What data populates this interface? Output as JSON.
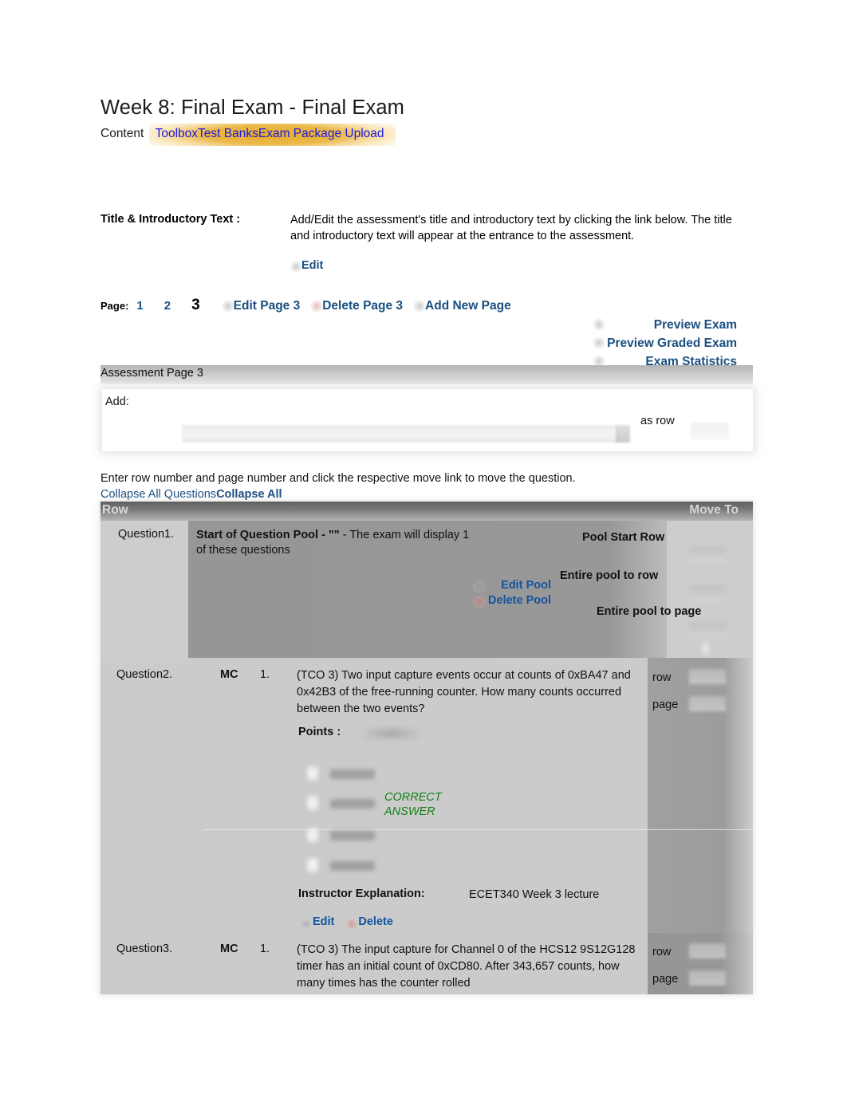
{
  "header": {
    "title": "Week 8: Final Exam - Final Exam",
    "breadcrumb_static": "Content",
    "breadcrumb_links": [
      {
        "label": "Toolbox"
      },
      {
        "label": "Test Banks"
      },
      {
        "label": "Exam Package Upload"
      }
    ]
  },
  "intro": {
    "label": "Title & Introductory Text :",
    "text": "Add/Edit the assessment's title and introductory text by clicking the link below. The title and introductory text will appear at the entrance to the assessment.",
    "edit_label": "Edit"
  },
  "pagenav": {
    "label": "Page:",
    "pages": [
      {
        "label": "1",
        "current": false
      },
      {
        "label": "2",
        "current": false
      },
      {
        "label": "3",
        "current": true
      }
    ],
    "actions": [
      {
        "label": "Edit Page 3"
      },
      {
        "label": "Delete Page 3"
      },
      {
        "label": "Add New Page"
      }
    ],
    "right_links": [
      {
        "label": "Preview Exam"
      },
      {
        "label": "Preview Graded Exam"
      },
      {
        "label": "Exam Statistics"
      }
    ]
  },
  "assessment_bar": {
    "title": "Assessment Page 3"
  },
  "add_panel": {
    "label": "Add:",
    "select_value": "",
    "as_row_label": "as row",
    "row_value": ""
  },
  "instructions": {
    "move_hint": "Enter row number and page number and click the respective move link to move the question.",
    "collapse_all_questions": "Collapse All Questions",
    "collapse_all": "Collapse All"
  },
  "table": {
    "headers": {
      "row": "Row",
      "move_to": "Move To"
    },
    "rows": [
      {
        "index_label": "Question1.",
        "kind": "pool",
        "pool_title_bold": "Start of Question Pool - \"\"",
        "pool_title_rest": " - The exam will display 1 of these questions",
        "links": [
          {
            "label": "Edit Pool"
          },
          {
            "label": "Delete Pool"
          }
        ],
        "move_options": [
          "Pool Start Row",
          "Entire pool to row",
          "Entire pool to page"
        ]
      },
      {
        "index_label": "Question2.",
        "kind": "question",
        "type": "MC",
        "number": "1.",
        "text": "(TCO 3) Two input capture events occur at counts of 0xBA47 and 0x42B3 of the free-running counter. How many counts occurred between the two events?",
        "points_label": "Points :",
        "points_value": "",
        "choices": [
          {
            "text": "",
            "correct": false
          },
          {
            "text": "",
            "correct": true
          },
          {
            "text": "",
            "correct": false
          },
          {
            "text": "",
            "correct": false
          }
        ],
        "correct_answer_label": "CORRECT ANSWER",
        "explanation_label": "Instructor Explanation:",
        "explanation_text": "ECET340 Week 3 lecture",
        "actions": [
          {
            "label": "Edit"
          },
          {
            "label": "Delete"
          }
        ],
        "move_row_label": "row",
        "move_page_label": "page",
        "move_row_value": "",
        "move_page_value": ""
      },
      {
        "index_label": "Question3.",
        "kind": "question",
        "type": "MC",
        "number": "1.",
        "text": "(TCO 3) The input capture for Channel 0 of the HCS12 9S12G128 timer has an initial count of 0xCD80. After 343,657 counts, how many times has the counter rolled",
        "move_row_label": "row",
        "move_page_label": "page",
        "move_row_value": "",
        "move_page_value": ""
      }
    ]
  },
  "colors": {
    "link_blue": "#1b4f81",
    "table_link_blue": "#13539e",
    "breadcrumb_blue": "#1a1ae0",
    "highlight_gold": "#e6a820",
    "correct_green": "#0f8014",
    "header_gray": "#777777",
    "body_gray": "#cbcbcb",
    "pool_gray": "#989898"
  }
}
